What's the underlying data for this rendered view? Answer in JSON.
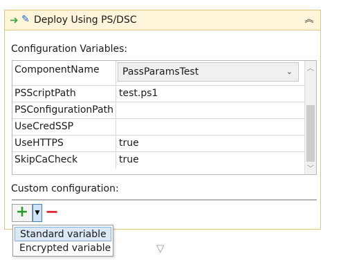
{
  "panel": {
    "title": "Deploy Using PS/DSC",
    "header_icons": [
      "arrow-right-icon",
      "pencil-icon"
    ],
    "collapse_icon": "chevron-double-up-icon",
    "collapse_glyph": "︽"
  },
  "config_vars": {
    "label": "Configuration Variables:",
    "rows": [
      {
        "name": "ComponentName",
        "value": "PassParamsTest",
        "type": "combo"
      },
      {
        "name": "PSScriptPath",
        "value": "test.ps1"
      },
      {
        "name": "PSConfigurationPath",
        "value": ""
      },
      {
        "name": "UseCredSSP",
        "value": ""
      },
      {
        "name": "UseHTTPS",
        "value": "true"
      },
      {
        "name": "SkipCaCheck",
        "value": "true"
      }
    ],
    "combo_arrow": "⌄"
  },
  "custom_config": {
    "label": "Custom configuration:",
    "add_symbol": "+",
    "dropdown_symbol": "▼",
    "remove_symbol": "−"
  },
  "menu": {
    "items": [
      "Standard variable",
      "Encrypted variable"
    ],
    "selected": "Standard variable"
  },
  "colors": {
    "header_bg": "#fdf5d9",
    "panel_border": "#e3c47a",
    "add_green": "#2e9a2e",
    "remove_red": "#e0242a",
    "menu_highlight": "#dbe9f7"
  }
}
